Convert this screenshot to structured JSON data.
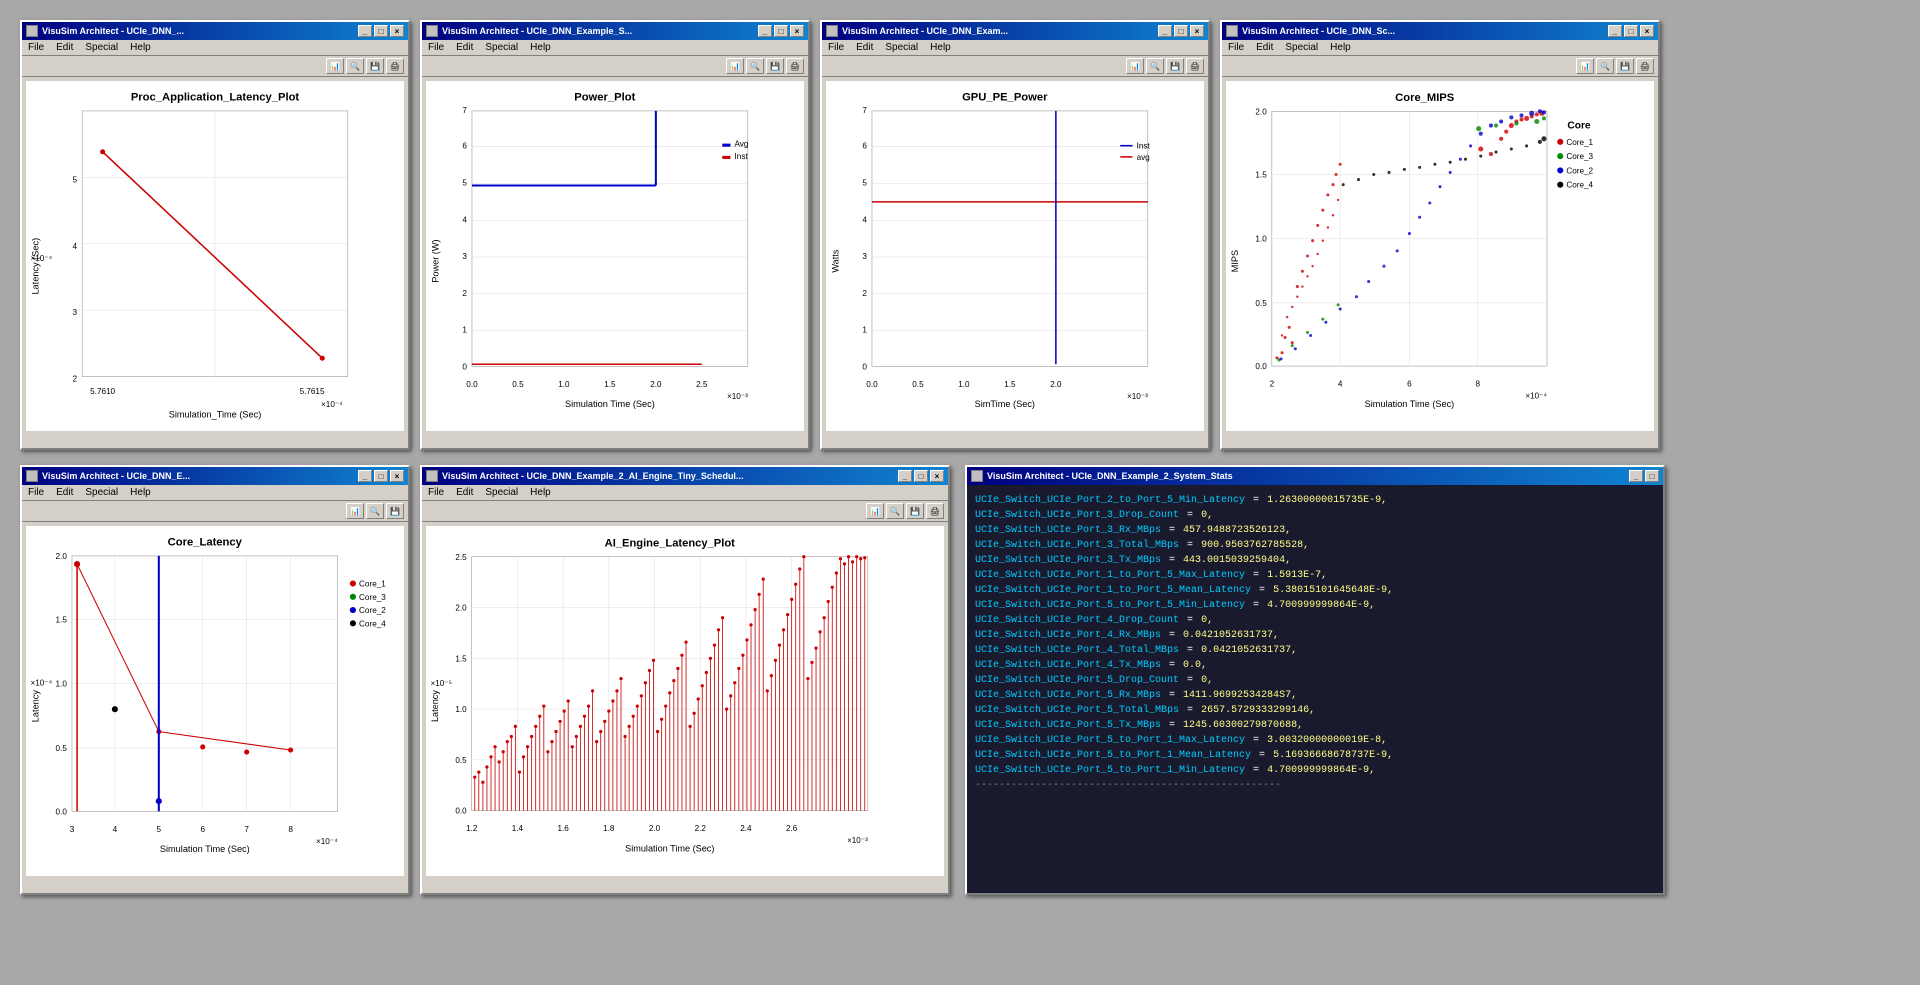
{
  "windows": {
    "proc_latency": {
      "title": "VisuSim Architect - UCIe_DNN_...",
      "menu": [
        "File",
        "Edit",
        "Special",
        "Help"
      ],
      "plot_title": "Proc_Application_Latency_Plot",
      "x_label": "Simulation_Time (Sec)",
      "y_label": "Latency (Sec)",
      "x_scale": "×10⁻⁴",
      "y_scale": "×10⁻⁴",
      "x_ticks": [
        "5.7610",
        "5.7615"
      ],
      "y_ticks": [
        "2",
        "3",
        "4",
        "5"
      ]
    },
    "power_plot": {
      "title": "VisuSim Architect - UCIe_DNN_Example_S...",
      "menu": [
        "File",
        "Edit",
        "Special",
        "Help"
      ],
      "plot_title": "Power_Plot",
      "x_label": "Simulation Time (Sec)",
      "y_label": "Power (W)",
      "x_scale": "×10⁻³",
      "legend": [
        "Avg",
        "Inst"
      ],
      "x_ticks": [
        "0.0",
        "0.5",
        "1.0",
        "1.5",
        "2.0",
        "2.5"
      ],
      "y_ticks": [
        "0",
        "1",
        "2",
        "3",
        "4",
        "5",
        "6",
        "7"
      ]
    },
    "gpu_pe_power": {
      "title": "VisuSim Architect - UCIe_DNN_Exam...",
      "menu": [
        "File",
        "Edit",
        "Special",
        "Help"
      ],
      "plot_title": "GPU_PE_Power",
      "x_label": "SimTime (Sec)",
      "y_label": "Watts",
      "x_scale": "×10⁻³",
      "legend": [
        "Inst",
        "avg"
      ],
      "x_ticks": [
        "0.0",
        "0.5",
        "1.0",
        "1.5",
        "2.0"
      ],
      "y_ticks": [
        "0",
        "1",
        "2",
        "3",
        "4",
        "5",
        "6",
        "7"
      ]
    },
    "core_mips": {
      "title": "VisuSim Architect - UCIe_DNN_Sc...",
      "menu": [
        "File",
        "Edit",
        "Special",
        "Help"
      ],
      "plot_title": "Core_MIPS",
      "x_label": "Simulation Time (Sec)",
      "y_label": "MIPS",
      "x_scale": "×10⁻⁴",
      "legend": [
        "Core_1",
        "Core_3",
        "Core_2",
        "Core_4"
      ],
      "legend_colors": [
        "red",
        "green",
        "blue",
        "black"
      ],
      "x_ticks": [
        "2",
        "4",
        "6",
        "8"
      ],
      "y_ticks": [
        "0.0",
        "0.5",
        "1.0",
        "1.5",
        "2.0"
      ]
    },
    "core_latency": {
      "title": "VisuSim Architect - UCIe_DNN_E...",
      "menu": [
        "File",
        "Edit",
        "Special",
        "Help"
      ],
      "plot_title": "Core_Latency",
      "x_label": "Simulation Time (Sec)",
      "y_label": "Latency",
      "x_scale": "×10⁻⁴",
      "legend": [
        "Core_1",
        "Core_3",
        "Core_2",
        "Core_4"
      ],
      "legend_colors": [
        "red",
        "green",
        "blue",
        "black"
      ],
      "x_ticks": [
        "3",
        "4",
        "5",
        "6",
        "7",
        "8"
      ],
      "y_ticks": [
        "0.0",
        "0.5",
        "1.0",
        "1.5",
        "2.0"
      ]
    },
    "ai_engine_latency": {
      "title": "VisuSim Architect - UCIe_DNN_Example_2_AI_Engine_Tiny_Schedul...",
      "menu": [
        "File",
        "Edit",
        "Special",
        "Help"
      ],
      "plot_title": "AI_Engine_Latency_Plot",
      "x_label": "Simulation Time (Sec)",
      "y_label": "Latency",
      "x_scale": "×10⁻³",
      "x_ticks": [
        "1.2",
        "1.4",
        "1.6",
        "1.8",
        "2.0",
        "2.2",
        "2.4",
        "2.6"
      ],
      "y_ticks": [
        "0.0",
        "0.5",
        "1.0",
        "1.5",
        "2.0",
        "2.5"
      ]
    },
    "system_stats": {
      "title": "VisuSim Architect - UCIe_DNN_Example_2_System_Stats",
      "stats": [
        {
          "key": "UCIe_Switch_UCIe_Port_2_to_Port_5_Min_Latency",
          "val": "= 1.26300000015735E-9,"
        },
        {
          "key": "UCIe_Switch_UCIe_Port_3_Drop_Count",
          "val": "= 0,"
        },
        {
          "key": "UCIe_Switch_UCIe_Port_3_Rx_MBps",
          "val": "= 457.9488723526123,"
        },
        {
          "key": "UCIe_Switch_UCIe_Port_3_Total_MBps",
          "val": "= 900.9503762785528,"
        },
        {
          "key": "UCIe_Switch_UCIe_Port_3_Tx_MBps",
          "val": "= 443.0015039259404,"
        },
        {
          "key": "UCIe_Switch_UCIe_Port_1_to_Port_5_Max_Latency",
          "val": "= 1.5913E-7,"
        },
        {
          "key": "UCIe_Switch_UCIe_Port_1_to_Port_5_Mean_Latency",
          "val": "= 5.38015101645648E-9,"
        },
        {
          "key": "UCIe_Switch_UCIe_Port_5_to_Port_5_Min_Latency",
          "val": "= 4.700999999864E-9,"
        },
        {
          "key": "UCIe_Switch_UCIe_Port_4_Drop_Count",
          "val": "= 0,"
        },
        {
          "key": "UCIe_Switch_UCIe_Port_4_Rx_MBps",
          "val": "= 0.0421052631737,"
        },
        {
          "key": "UCIe_Switch_UCIe_Port_4_Total_MBps",
          "val": "= 0.0421052631737,"
        },
        {
          "key": "UCIe_Switch_UCIe_Port_4_Tx_MBps",
          "val": "= 0.0,"
        },
        {
          "key": "UCIe_Switch_UCIe_Port_5_Drop_Count",
          "val": "= 0,"
        },
        {
          "key": "UCIe_Switch_UCIe_Port_5_Rx_MBps",
          "val": "= 1411.96992534284S7,"
        },
        {
          "key": "UCIe_Switch_UCIe_Port_5_Total_MBps",
          "val": "= 2657.5729333299146,"
        },
        {
          "key": "UCIe_Switch_UCIe_Port_5_Tx_MBps",
          "val": "= 1245.60300279870688,"
        },
        {
          "key": "UCIe_Switch_UCIe_Port_5_to_Port_1_Max_Latency",
          "val": "= 3.00320000000019E-8,"
        },
        {
          "key": "UCIe_Switch_UCIe_Port_5_to_Port_1_Mean_Latency",
          "val": "= 5.16936668678737E-9,"
        },
        {
          "key": "UCIe_Switch_UCIe_Port_5_to_Port_1_Min_Latency",
          "val": "= 4.700999999864E-9,"
        }
      ]
    }
  },
  "colors": {
    "title_bar_start": "#000080",
    "title_bar_end": "#1084d0",
    "window_bg": "#d4d0c8",
    "plot_bg": "#ffffff",
    "line_red": "#cc0000",
    "line_blue": "#0000cc",
    "line_green": "#008800",
    "line_black": "#000000",
    "stats_bg": "#1a1a2e",
    "stats_text": "#00ff00",
    "stats_key": "#00ccff",
    "stats_val": "#ffff00"
  }
}
